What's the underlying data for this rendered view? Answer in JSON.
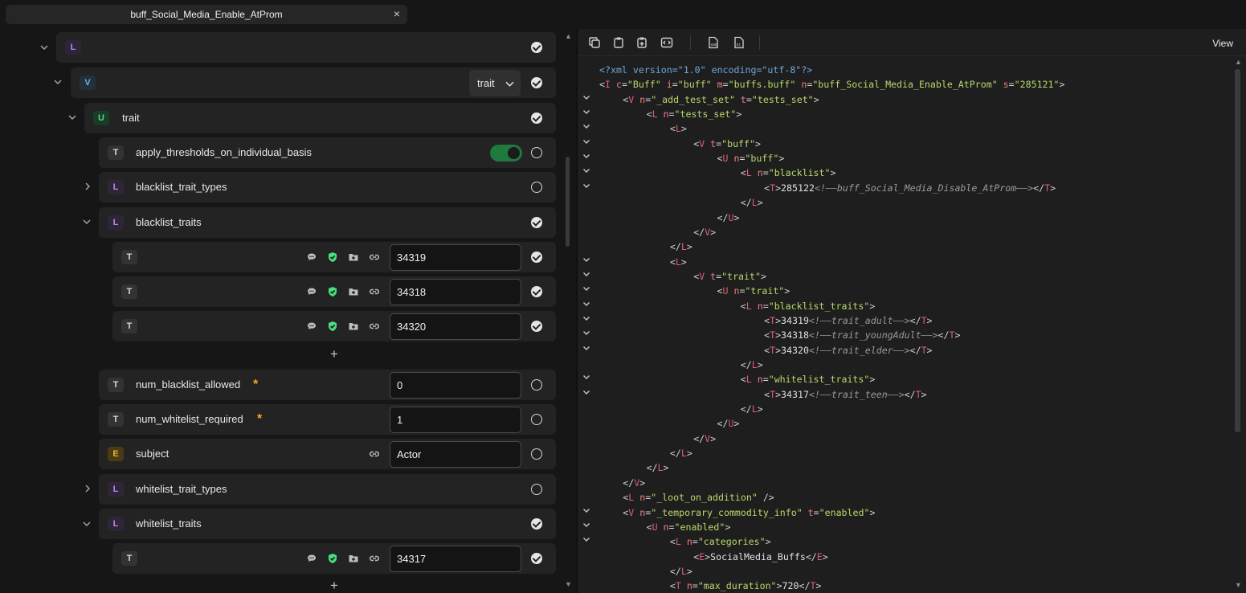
{
  "tab": {
    "title": "buff_Social_Media_Enable_AtProm",
    "close": "×"
  },
  "tree": {
    "root_badge": "L",
    "v_badge": "V",
    "v_select": "trait",
    "u_badge": "U",
    "u_label": "trait",
    "apply_thresholds": {
      "badge": "T",
      "label": "apply_thresholds_on_individual_basis",
      "toggle": "on"
    },
    "blacklist_trait_types": {
      "badge": "L",
      "label": "blacklist_trait_types"
    },
    "blacklist_traits": {
      "badge": "L",
      "label": "blacklist_traits",
      "items": [
        {
          "badge": "T",
          "value": "34319"
        },
        {
          "badge": "T",
          "value": "34318"
        },
        {
          "badge": "T",
          "value": "34320"
        }
      ]
    },
    "add": "+",
    "num_blacklist_allowed": {
      "badge": "T",
      "label": "num_blacklist_allowed",
      "value": "0",
      "required": "*"
    },
    "num_whitelist_required": {
      "badge": "T",
      "label": "num_whitelist_required",
      "value": "1",
      "required": "*"
    },
    "subject": {
      "badge": "E",
      "label": "subject",
      "value": "Actor"
    },
    "whitelist_trait_types": {
      "badge": "L",
      "label": "whitelist_trait_types"
    },
    "whitelist_traits": {
      "badge": "L",
      "label": "whitelist_traits",
      "items": [
        {
          "badge": "T",
          "value": "34317"
        }
      ]
    }
  },
  "toolbar": {
    "view_label": "View"
  },
  "icons": {
    "copy": "copy-icon",
    "paste": "clipboard-icon",
    "paste_special": "clipboard-plus-icon",
    "code": "code-icon",
    "xml_file": "xml-file-icon",
    "bin_file": "binary-file-icon",
    "comment": "comment-icon",
    "shield": "shield-check-icon",
    "folder": "folder-plus-icon",
    "link": "link-icon"
  },
  "colors": {
    "toggle_on": "#1f7a3d",
    "shield": "#4ade80",
    "required": "#f0a720"
  },
  "code": [
    [
      0,
      [
        [
          "pi",
          "<?xml version=\"1.0\" encoding=\"utf-8\"?>"
        ]
      ]
    ],
    [
      0,
      [
        [
          "br",
          "<"
        ],
        [
          "tag",
          "I"
        ],
        [
          "br",
          " "
        ],
        [
          "attr",
          "c"
        ],
        [
          "br",
          "="
        ],
        [
          "str",
          "\"Buff\""
        ],
        [
          "br",
          " "
        ],
        [
          "attr",
          "i"
        ],
        [
          "br",
          "="
        ],
        [
          "str",
          "\"buff\""
        ],
        [
          "br",
          " "
        ],
        [
          "attr",
          "m"
        ],
        [
          "br",
          "="
        ],
        [
          "str",
          "\"buffs.buff\""
        ],
        [
          "br",
          " "
        ],
        [
          "attr",
          "n"
        ],
        [
          "br",
          "="
        ],
        [
          "str",
          "\"buff_Social_Media_Enable_AtProm\""
        ],
        [
          "br",
          " "
        ],
        [
          "attr",
          "s"
        ],
        [
          "br",
          "="
        ],
        [
          "str",
          "\"285121\""
        ],
        [
          "br",
          ">"
        ]
      ]
    ],
    [
      1,
      [
        [
          "br",
          "<"
        ],
        [
          "tag",
          "V"
        ],
        [
          "br",
          " "
        ],
        [
          "attr",
          "n"
        ],
        [
          "br",
          "="
        ],
        [
          "str",
          "\"_add_test_set\""
        ],
        [
          "br",
          " "
        ],
        [
          "attr",
          "t"
        ],
        [
          "br",
          "="
        ],
        [
          "str",
          "\"tests_set\""
        ],
        [
          "br",
          ">"
        ]
      ],
      true
    ],
    [
      2,
      [
        [
          "br",
          "<"
        ],
        [
          "tag",
          "L"
        ],
        [
          "br",
          " "
        ],
        [
          "attr",
          "n"
        ],
        [
          "br",
          "="
        ],
        [
          "str",
          "\"tests_set\""
        ],
        [
          "br",
          ">"
        ]
      ],
      true
    ],
    [
      3,
      [
        [
          "br",
          "<"
        ],
        [
          "tag",
          "L"
        ],
        [
          "br",
          ">"
        ]
      ],
      true
    ],
    [
      4,
      [
        [
          "br",
          "<"
        ],
        [
          "tag",
          "V"
        ],
        [
          "br",
          " "
        ],
        [
          "attr",
          "t"
        ],
        [
          "br",
          "="
        ],
        [
          "str",
          "\"buff\""
        ],
        [
          "br",
          ">"
        ]
      ],
      true
    ],
    [
      5,
      [
        [
          "br",
          "<"
        ],
        [
          "tag",
          "U"
        ],
        [
          "br",
          " "
        ],
        [
          "attr",
          "n"
        ],
        [
          "br",
          "="
        ],
        [
          "str",
          "\"buff\""
        ],
        [
          "br",
          ">"
        ]
      ],
      true
    ],
    [
      6,
      [
        [
          "br",
          "<"
        ],
        [
          "tag",
          "L"
        ],
        [
          "br",
          " "
        ],
        [
          "attr",
          "n"
        ],
        [
          "br",
          "="
        ],
        [
          "str",
          "\"blacklist\""
        ],
        [
          "br",
          ">"
        ]
      ],
      true
    ],
    [
      7,
      [
        [
          "br",
          "<"
        ],
        [
          "tag",
          "T"
        ],
        [
          "br",
          ">"
        ],
        [
          "txt",
          "285122"
        ],
        [
          "com",
          "<!——buff_Social_Media_Disable_AtProm——>"
        ],
        [
          "br",
          "</"
        ],
        [
          "tag",
          "T"
        ],
        [
          "br",
          ">"
        ]
      ],
      true
    ],
    [
      6,
      [
        [
          "br",
          "</"
        ],
        [
          "tag",
          "L"
        ],
        [
          "br",
          ">"
        ]
      ]
    ],
    [
      5,
      [
        [
          "br",
          "</"
        ],
        [
          "tag",
          "U"
        ],
        [
          "br",
          ">"
        ]
      ]
    ],
    [
      4,
      [
        [
          "br",
          "</"
        ],
        [
          "tag",
          "V"
        ],
        [
          "br",
          ">"
        ]
      ]
    ],
    [
      3,
      [
        [
          "br",
          "</"
        ],
        [
          "tag",
          "L"
        ],
        [
          "br",
          ">"
        ]
      ]
    ],
    [
      3,
      [
        [
          "br",
          "<"
        ],
        [
          "tag",
          "L"
        ],
        [
          "br",
          ">"
        ]
      ],
      true
    ],
    [
      4,
      [
        [
          "br",
          "<"
        ],
        [
          "tag",
          "V"
        ],
        [
          "br",
          " "
        ],
        [
          "attr",
          "t"
        ],
        [
          "br",
          "="
        ],
        [
          "str",
          "\"trait\""
        ],
        [
          "br",
          ">"
        ]
      ],
      true
    ],
    [
      5,
      [
        [
          "br",
          "<"
        ],
        [
          "tag",
          "U"
        ],
        [
          "br",
          " "
        ],
        [
          "attr",
          "n"
        ],
        [
          "br",
          "="
        ],
        [
          "str",
          "\"trait\""
        ],
        [
          "br",
          ">"
        ]
      ],
      true
    ],
    [
      6,
      [
        [
          "br",
          "<"
        ],
        [
          "tag",
          "L"
        ],
        [
          "br",
          " "
        ],
        [
          "attr",
          "n"
        ],
        [
          "br",
          "="
        ],
        [
          "str",
          "\"blacklist_traits\""
        ],
        [
          "br",
          ">"
        ]
      ],
      true
    ],
    [
      7,
      [
        [
          "br",
          "<"
        ],
        [
          "tag",
          "T"
        ],
        [
          "br",
          ">"
        ],
        [
          "txt",
          "34319"
        ],
        [
          "com",
          "<!——trait_adult——>"
        ],
        [
          "br",
          "</"
        ],
        [
          "tag",
          "T"
        ],
        [
          "br",
          ">"
        ]
      ],
      true
    ],
    [
      7,
      [
        [
          "br",
          "<"
        ],
        [
          "tag",
          "T"
        ],
        [
          "br",
          ">"
        ],
        [
          "txt",
          "34318"
        ],
        [
          "com",
          "<!——trait_youngAdult——>"
        ],
        [
          "br",
          "</"
        ],
        [
          "tag",
          "T"
        ],
        [
          "br",
          ">"
        ]
      ],
      true
    ],
    [
      7,
      [
        [
          "br",
          "<"
        ],
        [
          "tag",
          "T"
        ],
        [
          "br",
          ">"
        ],
        [
          "txt",
          "34320"
        ],
        [
          "com",
          "<!——trait_elder——>"
        ],
        [
          "br",
          "</"
        ],
        [
          "tag",
          "T"
        ],
        [
          "br",
          ">"
        ]
      ],
      true
    ],
    [
      6,
      [
        [
          "br",
          "</"
        ],
        [
          "tag",
          "L"
        ],
        [
          "br",
          ">"
        ]
      ]
    ],
    [
      6,
      [
        [
          "br",
          "<"
        ],
        [
          "tag",
          "L"
        ],
        [
          "br",
          " "
        ],
        [
          "attr",
          "n"
        ],
        [
          "br",
          "="
        ],
        [
          "str",
          "\"whitelist_traits\""
        ],
        [
          "br",
          ">"
        ]
      ],
      true
    ],
    [
      7,
      [
        [
          "br",
          "<"
        ],
        [
          "tag",
          "T"
        ],
        [
          "br",
          ">"
        ],
        [
          "txt",
          "34317"
        ],
        [
          "com",
          "<!——trait_teen——>"
        ],
        [
          "br",
          "</"
        ],
        [
          "tag",
          "T"
        ],
        [
          "br",
          ">"
        ]
      ],
      true
    ],
    [
      6,
      [
        [
          "br",
          "</"
        ],
        [
          "tag",
          "L"
        ],
        [
          "br",
          ">"
        ]
      ]
    ],
    [
      5,
      [
        [
          "br",
          "</"
        ],
        [
          "tag",
          "U"
        ],
        [
          "br",
          ">"
        ]
      ]
    ],
    [
      4,
      [
        [
          "br",
          "</"
        ],
        [
          "tag",
          "V"
        ],
        [
          "br",
          ">"
        ]
      ]
    ],
    [
      3,
      [
        [
          "br",
          "</"
        ],
        [
          "tag",
          "L"
        ],
        [
          "br",
          ">"
        ]
      ]
    ],
    [
      2,
      [
        [
          "br",
          "</"
        ],
        [
          "tag",
          "L"
        ],
        [
          "br",
          ">"
        ]
      ]
    ],
    [
      1,
      [
        [
          "br",
          "</"
        ],
        [
          "tag",
          "V"
        ],
        [
          "br",
          ">"
        ]
      ]
    ],
    [
      1,
      [
        [
          "br",
          "<"
        ],
        [
          "tag",
          "L"
        ],
        [
          "br",
          " "
        ],
        [
          "attr",
          "n"
        ],
        [
          "br",
          "="
        ],
        [
          "str",
          "\"_loot_on_addition\""
        ],
        [
          "br",
          " />"
        ]
      ]
    ],
    [
      1,
      [
        [
          "br",
          "<"
        ],
        [
          "tag",
          "V"
        ],
        [
          "br",
          " "
        ],
        [
          "attr",
          "n"
        ],
        [
          "br",
          "="
        ],
        [
          "str",
          "\"_temporary_commodity_info\""
        ],
        [
          "br",
          " "
        ],
        [
          "attr",
          "t"
        ],
        [
          "br",
          "="
        ],
        [
          "str",
          "\"enabled\""
        ],
        [
          "br",
          ">"
        ]
      ],
      true
    ],
    [
      2,
      [
        [
          "br",
          "<"
        ],
        [
          "tag",
          "U"
        ],
        [
          "br",
          " "
        ],
        [
          "attr",
          "n"
        ],
        [
          "br",
          "="
        ],
        [
          "str",
          "\"enabled\""
        ],
        [
          "br",
          ">"
        ]
      ],
      true
    ],
    [
      3,
      [
        [
          "br",
          "<"
        ],
        [
          "tag",
          "L"
        ],
        [
          "br",
          " "
        ],
        [
          "attr",
          "n"
        ],
        [
          "br",
          "="
        ],
        [
          "str",
          "\"categories\""
        ],
        [
          "br",
          ">"
        ]
      ],
      true
    ],
    [
      4,
      [
        [
          "br",
          "<"
        ],
        [
          "tag",
          "E"
        ],
        [
          "br",
          ">"
        ],
        [
          "txt",
          "SocialMedia_Buffs"
        ],
        [
          "br",
          "</"
        ],
        [
          "tag",
          "E"
        ],
        [
          "br",
          ">"
        ]
      ]
    ],
    [
      3,
      [
        [
          "br",
          "</"
        ],
        [
          "tag",
          "L"
        ],
        [
          "br",
          ">"
        ]
      ]
    ],
    [
      3,
      [
        [
          "br",
          "<"
        ],
        [
          "tag",
          "T"
        ],
        [
          "br",
          " "
        ],
        [
          "attr",
          "n"
        ],
        [
          "br",
          "="
        ],
        [
          "str",
          "\"max_duration\""
        ],
        [
          "br",
          ">"
        ],
        [
          "txt",
          "720"
        ],
        [
          "br",
          "</"
        ],
        [
          "tag",
          "T"
        ],
        [
          "br",
          ">"
        ]
      ]
    ]
  ]
}
